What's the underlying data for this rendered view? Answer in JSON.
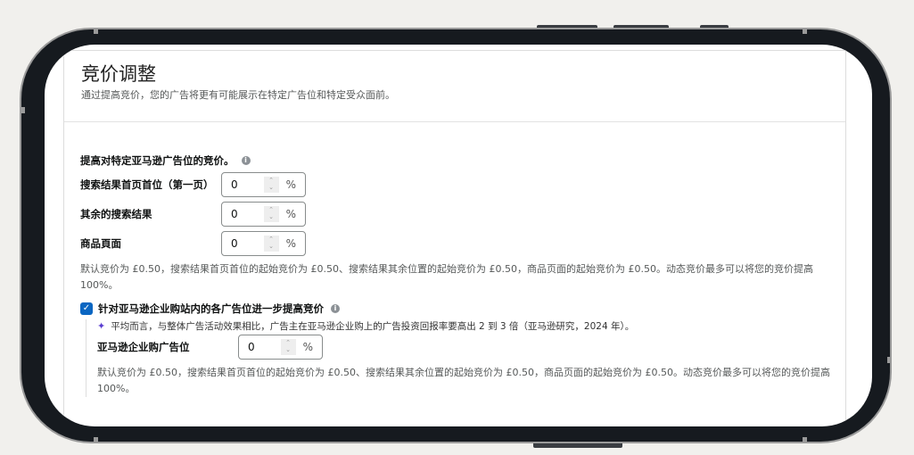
{
  "header": {
    "title": "竞价调整",
    "subtitle": "通过提高竞价，您的广告将更有可能展示在特定广告位和特定受众面前。"
  },
  "placements": {
    "heading": "提高对特定亚马逊广告位的竞价。",
    "rows": [
      {
        "label": "搜索结果首页首位（第一页）",
        "value": "0",
        "unit": "%"
      },
      {
        "label": "其余的搜索结果",
        "value": "0",
        "unit": "%"
      },
      {
        "label": "商品頁面",
        "value": "0",
        "unit": "%"
      }
    ],
    "note": "默认竞价为 £0.50，搜索结果首页首位的起始竞价为 £0.50、搜索结果其余位置的起始竞价为 £0.50，商品页面的起始竞价为 £0.50。动态竞价最多可以将您的竞价提高 100%。"
  },
  "business": {
    "checkbox_label": "针对亚马逊企业购站内的各广告位进一步提高竞价",
    "checked": true,
    "tip": "平均而言，与整体广告活动效果相比，广告主在亚马逊企业购上的广告投资回报率要高出 2 到 3 倍（亚马逊研究，2024 年）。",
    "row": {
      "label": "亚马逊企业购广告位",
      "value": "0",
      "unit": "%"
    },
    "note": "默认竞价为 £0.50，搜索结果首页首位的起始竞价为 £0.50、搜索结果其余位置的起始竞价为 £0.50，商品页面的起始竞价为 £0.50。动态竞价最多可以将您的竞价提高 100%。"
  }
}
